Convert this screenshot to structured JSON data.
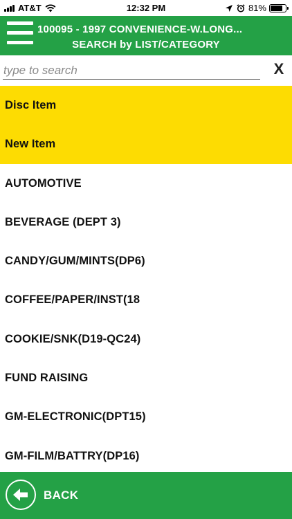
{
  "status_bar": {
    "carrier": "AT&T",
    "time": "12:32 PM",
    "battery_percent": "81%",
    "battery_level": 0.81
  },
  "header": {
    "title": "100095 - 1997 CONVENIENCE-W.LONG...",
    "subtitle": "SEARCH by LIST/CATEGORY"
  },
  "search": {
    "placeholder": "type to search",
    "value": "",
    "clear_label": "X"
  },
  "list": {
    "highlight_color": "#fddc02",
    "items": [
      {
        "label": "Disc Item",
        "highlighted": true
      },
      {
        "label": "New Item",
        "highlighted": true
      },
      {
        "label": "AUTOMOTIVE",
        "highlighted": false
      },
      {
        "label": "BEVERAGE (DEPT 3)",
        "highlighted": false
      },
      {
        "label": "CANDY/GUM/MINTS(DP6)",
        "highlighted": false
      },
      {
        "label": "COFFEE/PAPER/INST(18",
        "highlighted": false
      },
      {
        "label": "COOKIE/SNK(D19-QC24)",
        "highlighted": false
      },
      {
        "label": "FUND RAISING",
        "highlighted": false
      },
      {
        "label": "GM-ELECTRONIC(DPT15)",
        "highlighted": false
      },
      {
        "label": "GM-FILM/BATTRY(DP16)",
        "highlighted": false
      }
    ]
  },
  "footer": {
    "back_label": "BACK"
  },
  "theme": {
    "primary_green": "#24a146",
    "text_dark": "#111111"
  }
}
